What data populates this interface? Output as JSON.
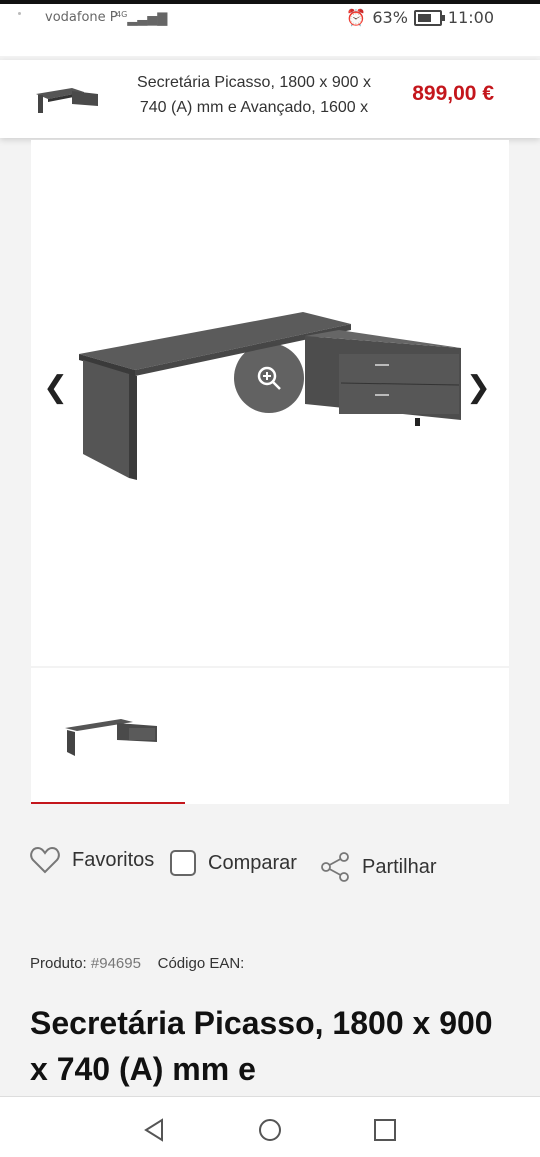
{
  "status_bar": {
    "carrier": "vodafone P",
    "network": "4G",
    "battery": "63%",
    "time": "11:00"
  },
  "sticky_header": {
    "title": "Secretária Picasso, 1800 x 900 x 740 (A) mm e Avançado, 1600 x",
    "price": "899,00 €"
  },
  "gallery": {
    "prev_icon": "chevron-left-icon",
    "next_icon": "chevron-right-icon",
    "zoom_icon": "zoom-in-icon"
  },
  "actions": {
    "favorites": "Favoritos",
    "compare": "Comparar",
    "share": "Partilhar"
  },
  "product": {
    "product_label": "Produto:",
    "product_number": "#94695",
    "ean_label": "Código EAN:",
    "title": "Secretária Picasso, 1800 x 900 x 740 (A) mm e"
  },
  "colors": {
    "accent": "#c4161c",
    "background": "#f3f3f3"
  }
}
